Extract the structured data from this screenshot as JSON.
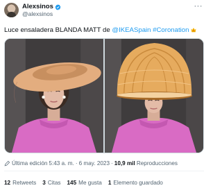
{
  "author": {
    "name": "Alexsinos",
    "handle": "@alexsinos",
    "verified": true
  },
  "tweet": {
    "text_prefix": "Luce ensaladera BLANDA MATT de ",
    "mention": "@IKEASpain",
    "hashtag": "#Coronation",
    "crown_emoji": "👑"
  },
  "media": {
    "photos": [
      {
        "description": "woman-in-pink-with-large-wide-brim-hat"
      },
      {
        "description": "woman-in-pink-with-wooden-bowl-lamp-as-hat"
      }
    ]
  },
  "meta": {
    "edited_label": "Última edición",
    "time": "5:43 a. m.",
    "separator": "·",
    "date": "6 may. 2023",
    "views_count": "10,9 mil",
    "views_label": "Reproducciones"
  },
  "stats": [
    {
      "count": "12",
      "label": "Retweets"
    },
    {
      "count": "3",
      "label": "Citas"
    },
    {
      "count": "145",
      "label": "Me gusta"
    },
    {
      "count": "1",
      "label": "Elemento guardado"
    }
  ],
  "colors": {
    "link": "#1d9bf0",
    "secondary_text": "#536471",
    "dress_pink": "#d96bc4"
  }
}
